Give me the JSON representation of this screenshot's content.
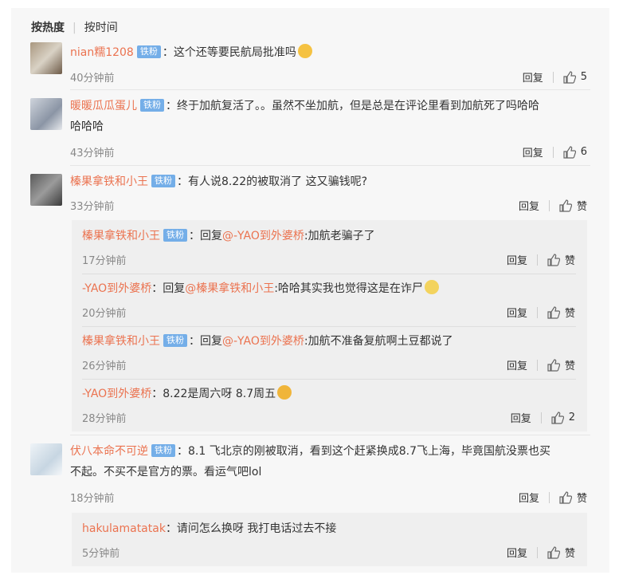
{
  "sort": {
    "hot": "按热度",
    "time": "按时间"
  },
  "comments": [
    {
      "user": "nian糯1208",
      "badge": "铁粉",
      "text": "这个还等要民航局批准吗",
      "time": "40分钟前",
      "reply": "回复",
      "likes": "5"
    },
    {
      "user": "暖暖瓜瓜蛋儿",
      "badge": "铁粉",
      "text": "终于加航复活了。。虽然不坐加航，但是总是在评论里看到加航死了吗哈哈",
      "text2": "哈哈哈",
      "time": "43分钟前",
      "reply": "回复",
      "likes": "6"
    },
    {
      "user": "榛果拿铁和小王",
      "badge": "铁粉",
      "text": "有人说8.22的被取消了 这又骗钱呢?",
      "time": "33分钟前",
      "reply": "回复",
      "likes": "赞"
    },
    {
      "user": "伏八本命不可逆",
      "badge": "铁粉",
      "text": "8.1 飞北京的刚被取消，看到这个赶紧换成8.7飞上海，毕竟国航没票也买",
      "text2": "不起。不买不是官方的票。看运气吧lol",
      "time": "18分钟前",
      "reply": "回复",
      "likes": "赞"
    }
  ],
  "replies": [
    {
      "user": "榛果拿铁和小王",
      "badge": "铁粉",
      "prefix": "：回复",
      "mention": "@-YAO到外婆桥",
      "text": ":加航老骗子了",
      "time": "17分钟前",
      "reply": "回复",
      "likes": "赞"
    },
    {
      "user": "-YAO到外婆桥",
      "prefix": "：回复",
      "mention": "@榛果拿铁和小王",
      "text": ":哈哈其实我也觉得这是在诈尸",
      "time": "20分钟前",
      "reply": "回复",
      "likes": "赞"
    },
    {
      "user": "榛果拿铁和小王",
      "badge": "铁粉",
      "prefix": "：回复",
      "mention": "@-YAO到外婆桥",
      "text": ":加航不准备复航啊土豆都说了",
      "time": "26分钟前",
      "reply": "回复",
      "likes": "赞"
    },
    {
      "user": "-YAO到外婆桥",
      "text": "：8.22是周六呀 8.7周五",
      "time": "28分钟前",
      "reply": "回复",
      "likes": "2"
    },
    {
      "user": "hakulamatatak",
      "text": "：请问怎么换呀 我打电话过去不接",
      "time": "5分钟前",
      "reply": "回复",
      "likes": "赞"
    }
  ],
  "colors": {
    "username": "#eb7350",
    "badge": "#74aee8",
    "time": "#888888"
  }
}
